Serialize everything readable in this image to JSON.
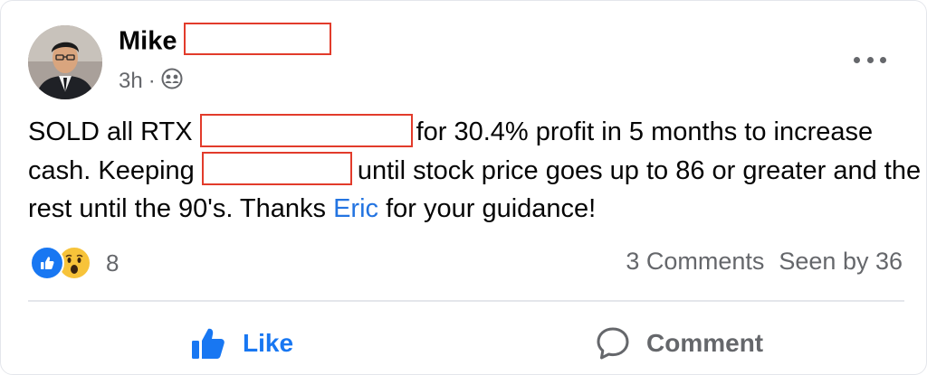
{
  "post": {
    "author_name": "Mike",
    "timestamp": "3h",
    "separator": "·",
    "audience_icon": "friends-icon",
    "text": {
      "part1": "SOLD all RTX",
      "part2": "for 30.4% profit in 5 months to increase cash. Keeping",
      "part3": "until stock price goes up to 86 or greater and the rest until the 90's. Thanks",
      "mention": "Eric",
      "part4": "for your guidance!"
    },
    "reactions": {
      "icons": [
        "like-reaction-icon",
        "wow-reaction-icon"
      ],
      "count": "8"
    },
    "stats": {
      "comments": "3 Comments",
      "seen": "Seen by 36"
    },
    "actions": {
      "like_label": "Like",
      "comment_label": "Comment"
    }
  },
  "colors": {
    "accent": "#1877f2",
    "link": "#2374e1",
    "redaction": "#e23b2b",
    "secondary_text": "#65676b"
  }
}
